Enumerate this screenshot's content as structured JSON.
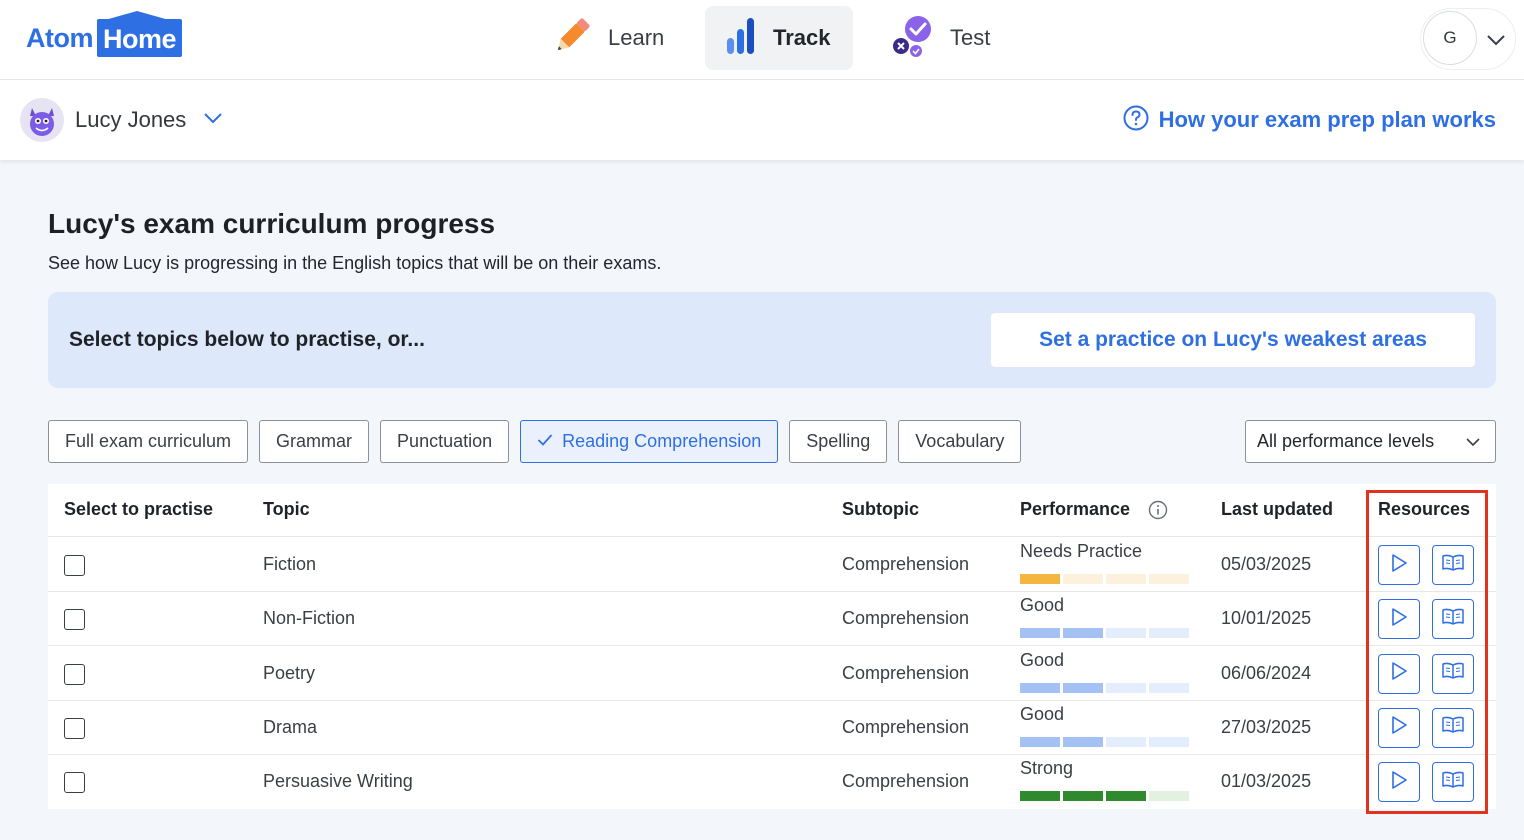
{
  "logo": {
    "part1": "Atom",
    "part2": "Home"
  },
  "nav": {
    "learn": "Learn",
    "track": "Track",
    "test": "Test"
  },
  "user": {
    "initial": "G"
  },
  "student": {
    "name": "Lucy Jones"
  },
  "help": {
    "label": "How your exam prep plan works"
  },
  "page": {
    "title": "Lucy's exam curriculum progress",
    "subtitle": "See how Lucy is progressing in the English topics that will be on their exams."
  },
  "banner": {
    "text": "Select topics below to practise, or...",
    "button": "Set a practice on Lucy's weakest areas"
  },
  "filters": [
    {
      "label": "Full exam curriculum",
      "active": false
    },
    {
      "label": "Grammar",
      "active": false
    },
    {
      "label": "Punctuation",
      "active": false
    },
    {
      "label": "Reading Comprehension",
      "active": true
    },
    {
      "label": "Spelling",
      "active": false
    },
    {
      "label": "Vocabulary",
      "active": false
    }
  ],
  "performance_filter": {
    "selected": "All performance levels"
  },
  "table": {
    "headers": {
      "select": "Select to practise",
      "topic": "Topic",
      "subtopic": "Subtopic",
      "performance": "Performance",
      "last_updated": "Last updated",
      "resources": "Resources"
    },
    "rows": [
      {
        "topic": "Fiction",
        "subtopic": "Comprehension",
        "performance": "Needs Practice",
        "level": 1,
        "date": "05/03/2025"
      },
      {
        "topic": "Non-Fiction",
        "subtopic": "Comprehension",
        "performance": "Good",
        "level": 2,
        "date": "10/01/2025"
      },
      {
        "topic": "Poetry",
        "subtopic": "Comprehension",
        "performance": "Good",
        "level": 2,
        "date": "06/06/2024"
      },
      {
        "topic": "Drama",
        "subtopic": "Comprehension",
        "performance": "Good",
        "level": 2,
        "date": "27/03/2025"
      },
      {
        "topic": "Persuasive Writing",
        "subtopic": "Comprehension",
        "performance": "Strong",
        "level": 3,
        "date": "01/03/2025"
      }
    ]
  },
  "colors": {
    "accent": "#2f6fe4",
    "needs_practice": "#f5b63f",
    "needs_practice_light": "#fcf1dd",
    "good": "#a3c1f3",
    "good_light": "#e3edfc",
    "strong": "#2e8a2c",
    "strong_light": "#e3f1e1",
    "highlight": "#e0341f"
  },
  "icons": {
    "learn": "pencil-icon",
    "track": "bar-chart-icon",
    "test": "test-check-icon",
    "help": "question-circle-icon",
    "video": "play-icon",
    "book": "book-icon",
    "info": "info-icon"
  }
}
